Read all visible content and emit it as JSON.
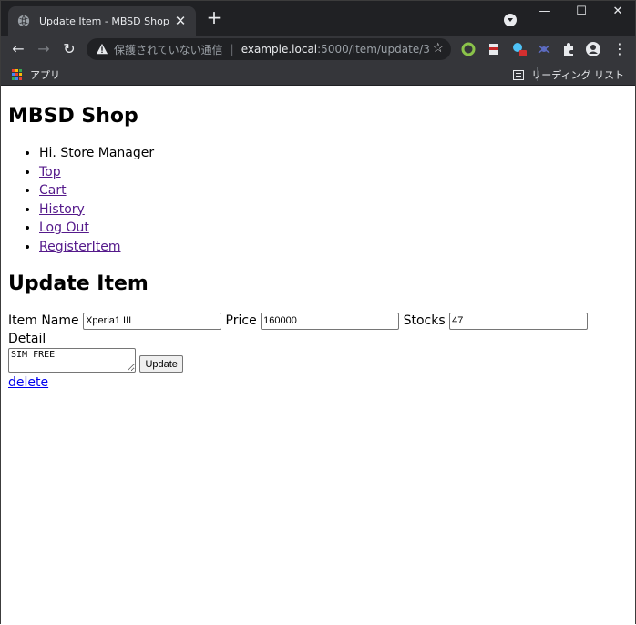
{
  "browser": {
    "tab_title": "Update Item - MBSD Shop",
    "tab_close": "✕",
    "new_tab": "+",
    "window_controls": {
      "minimize": "—",
      "maximize": "☐",
      "close": "✕"
    },
    "nav": {
      "back": "←",
      "forward": "→",
      "reload": "↻"
    },
    "omnibox": {
      "security_label": "保護されていない通信",
      "separator": "|",
      "host": "example.local",
      "path": ":5000/item/update/3",
      "star": "☆"
    },
    "menu": "⋮",
    "bookmarks": {
      "apps_label": "アプリ",
      "reading_list_label": "リーディング リスト"
    }
  },
  "page": {
    "site_title": "MBSD Shop",
    "greeting": "Hi. Store Manager",
    "nav_links": [
      "Top",
      "Cart",
      "History",
      "Log Out",
      "RegisterItem"
    ],
    "heading": "Update Item",
    "form": {
      "item_name_label": "Item Name",
      "item_name_value": "Xperia1 III",
      "price_label": "Price",
      "price_value": "160000",
      "stocks_label": "Stocks",
      "stocks_value": "47",
      "detail_label": "Detail",
      "detail_value": "SIM FREE",
      "update_button": "Update"
    },
    "delete_link": "delete"
  },
  "colors": {
    "tabstrip": "#202124",
    "toolbar": "#35363a",
    "visited_link": "#551a8b",
    "link": "#0000ee",
    "warning": "#e8eaed"
  },
  "icons": [
    "globe-icon",
    "warning-icon",
    "star-icon",
    "apps-icon",
    "reading-list-icon",
    "puzzle-icon",
    "avatar-icon",
    "menu-icon"
  ]
}
